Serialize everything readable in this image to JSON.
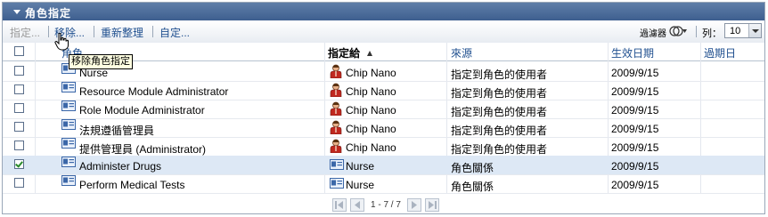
{
  "panel": {
    "title": "角色指定"
  },
  "toolbar": {
    "assign_label": "指定...",
    "remove_label": "移除...",
    "refresh_label": "重新整理",
    "customize_label": "自定...",
    "filter_label": "過濾器",
    "rows_label": "列：",
    "rows_value": "10"
  },
  "table": {
    "columns": {
      "role": "角色",
      "assigned_to": "指定給",
      "source": "來源",
      "effective_date": "生效日期",
      "expiration_date": "過期日"
    },
    "rows": [
      {
        "role": "Nurse",
        "assigned_to": "Chip Nano",
        "assigned_icon": "user-icon",
        "source": "指定到角色的使用者",
        "effective_date": "2009/9/15",
        "checked": false,
        "selected": false
      },
      {
        "role": "Resource Module Administrator",
        "assigned_to": "Chip Nano",
        "assigned_icon": "user-icon",
        "source": "指定到角色的使用者",
        "effective_date": "2009/9/15",
        "checked": false,
        "selected": false
      },
      {
        "role": "Role Module Administrator",
        "assigned_to": "Chip Nano",
        "assigned_icon": "user-icon",
        "source": "指定到角色的使用者",
        "effective_date": "2009/9/15",
        "checked": false,
        "selected": false
      },
      {
        "role": "法規遵循管理員",
        "assigned_to": "Chip Nano",
        "assigned_icon": "user-icon",
        "source": "指定到角色的使用者",
        "effective_date": "2009/9/15",
        "checked": false,
        "selected": false
      },
      {
        "role": "提供管理員 (Administrator)",
        "assigned_to": "Chip Nano",
        "assigned_icon": "user-icon",
        "source": "指定到角色的使用者",
        "effective_date": "2009/9/15",
        "checked": false,
        "selected": false
      },
      {
        "role": "Administer Drugs",
        "assigned_to": "Nurse",
        "assigned_icon": "role-icon",
        "source": "角色關係",
        "effective_date": "2009/9/15",
        "checked": true,
        "selected": true
      },
      {
        "role": "Perform Medical Tests",
        "assigned_to": "Nurse",
        "assigned_icon": "role-icon",
        "source": "角色關係",
        "effective_date": "2009/9/15",
        "checked": false,
        "selected": false
      }
    ]
  },
  "tooltip": {
    "text": "移除角色指定"
  },
  "pager": {
    "range": "1 - 7 / 7"
  },
  "colors": {
    "title_bar": "#4a6a99",
    "link": "#1f4f8f",
    "selected_row": "#dde8f5",
    "tooltip_bg": "#ffffe1"
  }
}
